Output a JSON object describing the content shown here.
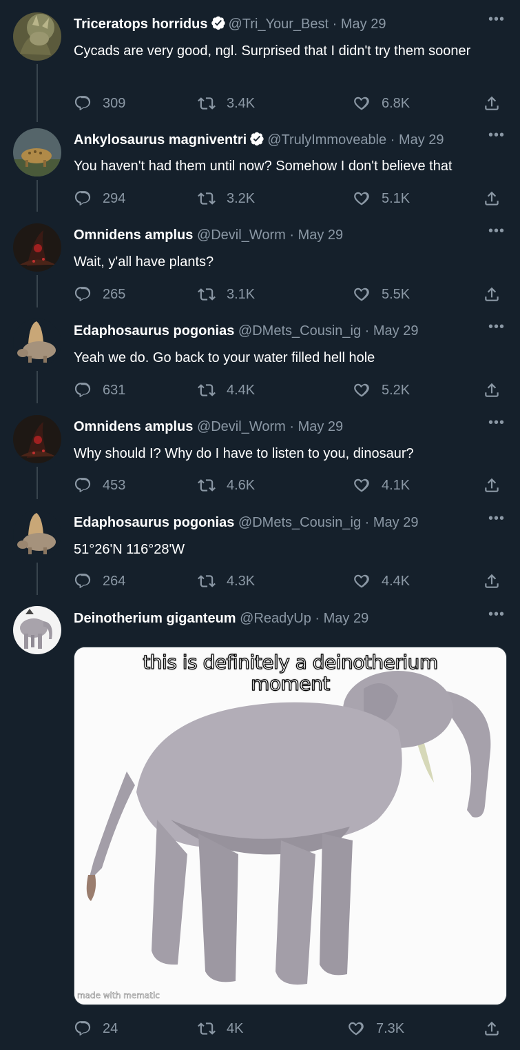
{
  "colors": {
    "background": "#15202b",
    "secondary_text": "#8b98a5",
    "verified": "#ffffff",
    "thread_line": "#38444d"
  },
  "tweets": [
    {
      "name": "Triceratops horridus",
      "verified": true,
      "handle": "@Tri_Your_Best",
      "separator": "·",
      "date": "May 29",
      "text": "Cycads are very good, ngl. Surprised that I didn't try them sooner",
      "replies": "309",
      "retweets": "3.4K",
      "likes": "6.8K",
      "more": "•••"
    },
    {
      "name": "Ankylosaurus magniventri",
      "verified": true,
      "handle": "@TrulyImmoveable",
      "separator": "·",
      "date": "May 29",
      "text": "You haven't had them until now? Somehow I don't believe that",
      "replies": "294",
      "retweets": "3.2K",
      "likes": "5.1K",
      "more": "•••"
    },
    {
      "name": "Omnidens amplus",
      "verified": false,
      "handle": "@Devil_Worm",
      "separator": "·",
      "date": "May 29",
      "text": "Wait, y'all have plants?",
      "replies": "265",
      "retweets": "3.1K",
      "likes": "5.5K",
      "more": "•••"
    },
    {
      "name": "Edaphosaurus pogonias",
      "verified": false,
      "handle": "@DMets_Cousin_ig",
      "separator": "·",
      "date": "May 29",
      "text": "Yeah we do. Go back to your water filled hell hole",
      "replies": "631",
      "retweets": "4.4K",
      "likes": "5.2K",
      "more": "•••"
    },
    {
      "name": "Omnidens amplus",
      "verified": false,
      "handle": "@Devil_Worm",
      "separator": "·",
      "date": "May 29",
      "text": "Why should I? Why do I have to listen to you, dinosaur?",
      "replies": "453",
      "retweets": "4.6K",
      "likes": "4.1K",
      "more": "•••"
    },
    {
      "name": "Edaphosaurus pogonias",
      "verified": false,
      "handle": "@DMets_Cousin_ig",
      "separator": "·",
      "date": "May 29",
      "text": "51°26'N 116°28'W",
      "replies": "264",
      "retweets": "4.3K",
      "likes": "4.4K",
      "more": "•••"
    },
    {
      "name": "Deinotherium giganteum",
      "verified": false,
      "handle": "@ReadyUp",
      "separator": "·",
      "date": "May 29",
      "text": "",
      "replies": "24",
      "retweets": "4K",
      "likes": "7.3K",
      "more": "•••",
      "media": {
        "caption_line1": "this is definitely a deinotherium",
        "caption_line2": "moment",
        "watermark": "made with mematic"
      }
    }
  ]
}
